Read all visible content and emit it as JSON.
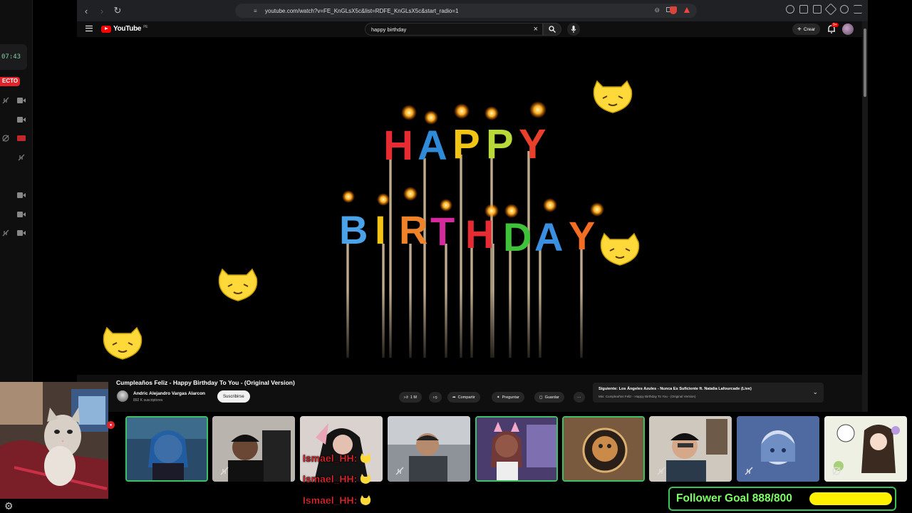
{
  "left_rail": {
    "clock": "07:43",
    "live_badge": "ECTO"
  },
  "browser": {
    "url": "youtube.com/watch?v=FE_KnGLsX5c&list=RDFE_KnGLsX5c&start_radio=1"
  },
  "youtube": {
    "logo_text": "YouTube",
    "logo_country": "PE",
    "search_value": "happy birthday",
    "create_label": "Crear",
    "bell_badge": "9+"
  },
  "video": {
    "title": "Cumpleaños Feliz - Happy Birthday To You - (Original Version)",
    "channel_name": "Andric Alejandro Vargas Alarcon",
    "channel_subs": "892 K suscriptores",
    "subscribe_label": "Suscribirse",
    "likes": "1 M",
    "share_label": "Compartir",
    "ask_label": "Preguntar",
    "save_label": "Guardar",
    "more_label": "···",
    "candles_line1": "HAPPY",
    "candles_line2": "BIRTHDAY"
  },
  "up_next": {
    "title": "Siguiente: Los Ángeles Azules - Nunca Es Suficiente ft. Natalia Lafourcade (Live)",
    "subtitle": "Mix: Cumpleaños Feliz - Happy Birthday To You - (Original Version)"
  },
  "chat": {
    "lines": [
      "Ismael_HH:",
      "Ismael_HH:",
      "Ismael_HH:"
    ]
  },
  "follower_goal": {
    "label": "Follower Goal 888/800",
    "progress_fraction": 1.0
  },
  "colors": {
    "youtube_red": "#ff0000",
    "speaking_border": "#3fbf66",
    "chat_name": "#e2262a",
    "goal_text": "#7dff66",
    "goal_bar": "#fff000"
  }
}
